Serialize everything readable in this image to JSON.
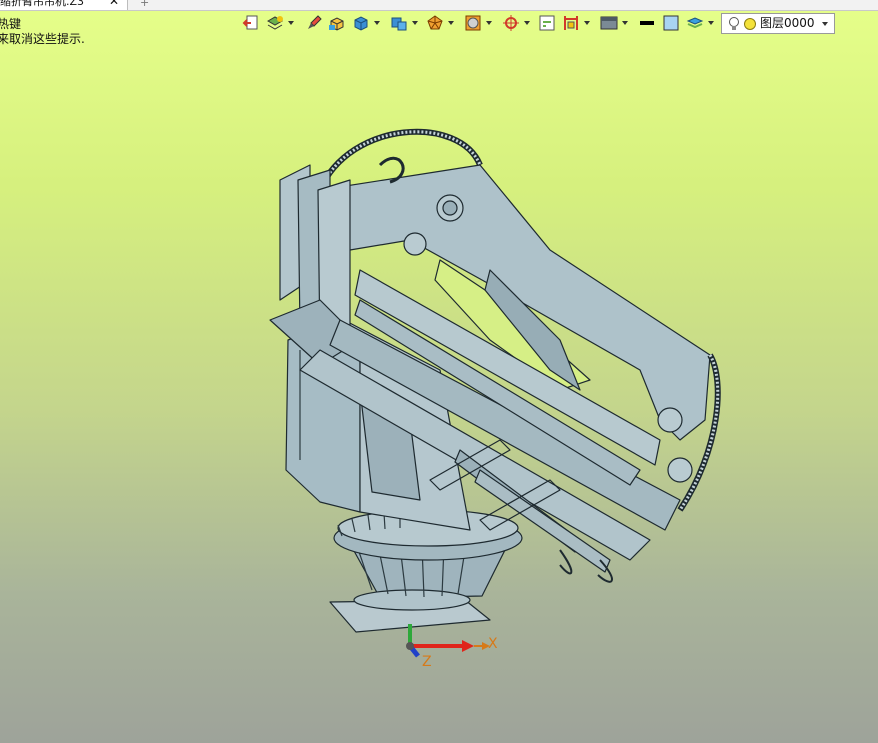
{
  "tab": {
    "title": "缩折臂吊吊机.Z3",
    "close": "✕",
    "add": "+"
  },
  "hints": {
    "line1": "热键",
    "line2": "来取消这些提示."
  },
  "layer": {
    "name": "图层0000"
  },
  "axes": {
    "x": "X",
    "z": "Z"
  },
  "toolbar": {
    "icons": [
      "exit-icon",
      "layers-icon",
      "brush-icon",
      "solid-icon",
      "box-icon",
      "view-cube-icon",
      "polyhedron-icon",
      "render-mode-icon",
      "origin-icon",
      "grid-icon",
      "dimension-icon",
      "display-icon",
      "line-color-icon",
      "fill-color-icon",
      "layer-stack-icon"
    ]
  },
  "colors": {
    "background_top": "#e6ff8a",
    "background_bottom": "#9ea39a",
    "model": "#a9bfc8",
    "axis_x": "#e0251b",
    "axis_y": "#2ea83a",
    "axis_z": "#2142c9"
  }
}
